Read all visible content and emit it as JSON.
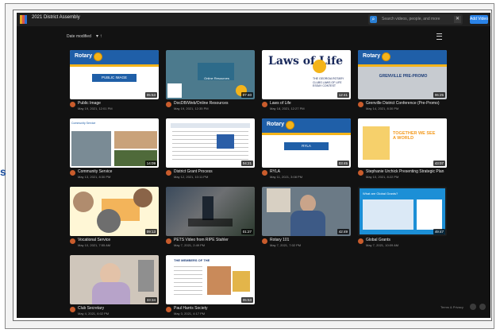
{
  "app": {
    "title": "2021 District Assembly",
    "search_placeholder": "Search videos, people, and more",
    "add_button": "Add Video",
    "sort_label": "Date modified",
    "accent_color": "#2a83e8"
  },
  "tiles": [
    {
      "title": "Public Image",
      "date": "May 19, 2021, 12:01 PM",
      "duration": "05:53",
      "thumb_text": "PUBLIC IMAGE"
    },
    {
      "title": "DocDB/Web/Online Resources",
      "date": "May 19, 2021, 12:35 PM",
      "duration": "07:40",
      "thumb_text": "Online Resources"
    },
    {
      "title": "Laws of Life",
      "date": "May 18, 2021, 12:27 PM",
      "duration": "12:41",
      "thumb_text": "Laws of Life"
    },
    {
      "title": "Grenville District Conference (Pre-Promo)",
      "date": "May 14, 2021, 8:30 PM",
      "duration": "06:25",
      "thumb_text": "GRENVILLE PRE-PROMO"
    },
    {
      "title": "Community Service",
      "date": "May 13, 2021, 8:30 PM",
      "duration": "14:09",
      "thumb_text": "Community Service"
    },
    {
      "title": "District Grant Process",
      "date": "May 12, 2021, 10:11 PM",
      "duration": "04:21",
      "thumb_text": ""
    },
    {
      "title": "RYLA",
      "date": "May 11, 2021, 3:08 PM",
      "duration": "03:45",
      "thumb_text": "RYLA"
    },
    {
      "title": "Stephanie Urchick Presenting Strategic Plan",
      "date": "May 10, 2021, 8:22 PM",
      "duration": "43:07",
      "thumb_text": "TOGETHER WE SEE A WORLD"
    },
    {
      "title": "Vocational Service",
      "date": "May 10, 2021, 7:55 AM",
      "duration": "09:13",
      "thumb_text": ""
    },
    {
      "title": "PETS Video from RIPE Stahler",
      "date": "May 7, 2021, 2:49 PM",
      "duration": "01:27",
      "thumb_text": ""
    },
    {
      "title": "Rotary 101",
      "date": "May 7, 2021, 7:02 PM",
      "duration": "42:49",
      "thumb_text": ""
    },
    {
      "title": "Global Grants",
      "date": "May 7, 2021, 10:09 AM",
      "duration": "49:47",
      "thumb_text": "What are Global Grants?"
    },
    {
      "title": "Club Secretary",
      "date": "May 4, 2021, 6:02 PM",
      "duration": "33:34",
      "thumb_text": ""
    },
    {
      "title": "Paul Harris Society",
      "date": "May 3, 2021, 4:17 PM",
      "duration": "05:53",
      "thumb_text": "THE MEMBERS OF THE"
    }
  ],
  "footer": {
    "text": "Terms & Privacy"
  }
}
